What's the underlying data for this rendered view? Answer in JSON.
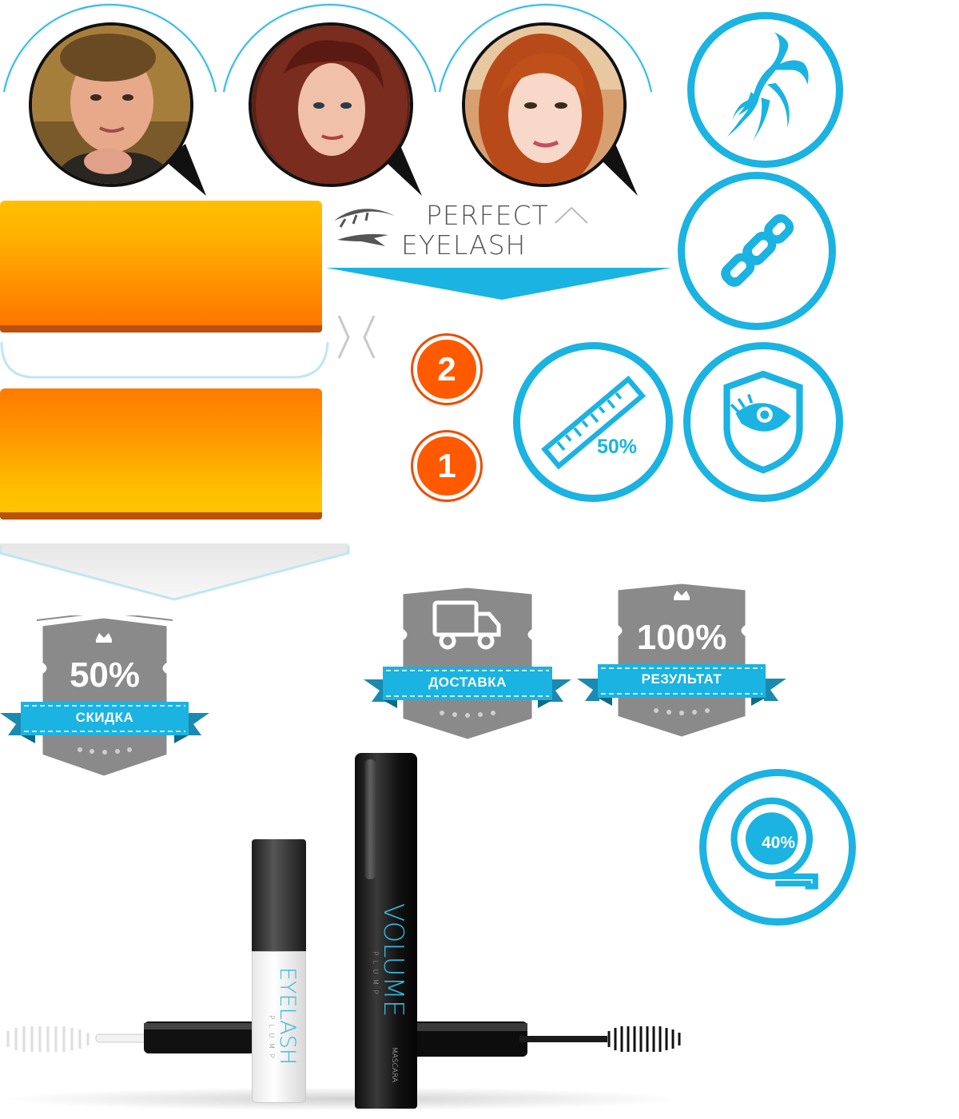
{
  "logo": {
    "line1": "PERFECT",
    "line2": "EYELASH"
  },
  "steps": {
    "step_2": "2",
    "step_1": "1"
  },
  "feature_icons": [
    "ginseng-icon",
    "chain-link-icon",
    "ruler-icon",
    "eye-shield-icon",
    "tape-measure-icon"
  ],
  "ruler_value": "50%",
  "tape_value": "40%",
  "badges": {
    "discount": {
      "value": "50%",
      "label": "СКИДКА"
    },
    "delivery": {
      "label": "ДОСТАВКА",
      "icon": "truck-icon"
    },
    "result": {
      "value": "100%",
      "label": "РЕЗУЛЬТАТ"
    }
  },
  "products": {
    "eyelash": {
      "name": "EYELASH",
      "sub": "PLUMP"
    },
    "volume": {
      "name": "VOLUME",
      "sub": "PLUMP",
      "type": "MASCARA"
    }
  },
  "colors": {
    "accent": "#1ab3e2",
    "orange": "#ff9400",
    "badge_gray": "#8a8a8a",
    "step_badge": "#ff5a00"
  }
}
